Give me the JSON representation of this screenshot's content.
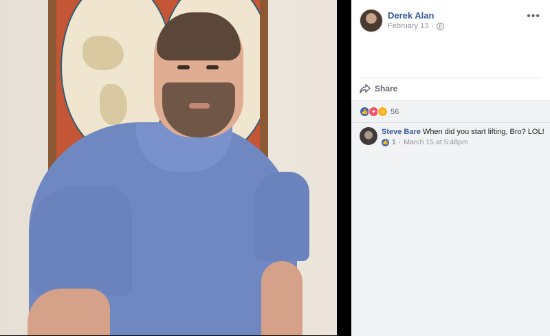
{
  "post": {
    "author": "Derek Alan",
    "date": "February 13",
    "date_separator": "·",
    "more_label": "•••",
    "share_label": "Share",
    "reaction_count": "56"
  },
  "comment": {
    "author": "Steve Bare",
    "text": "When did you start lifting, Bro? LOL!",
    "like_count": "1",
    "meta_separator": "·",
    "time": "March 15 at 5:48pm"
  },
  "icons": {
    "privacy": "globe-icon",
    "options": "more-options-icon",
    "share": "share-arrow-icon",
    "reactions": [
      "like-icon",
      "love-icon",
      "wow-icon"
    ]
  },
  "colors": {
    "author_link": "#365899",
    "like_blue": "#4267b2",
    "love_red": "#f25268",
    "wow_yellow": "#f7b125",
    "meta_gray": "#90949c",
    "comment_area": "#f2f3f5"
  }
}
